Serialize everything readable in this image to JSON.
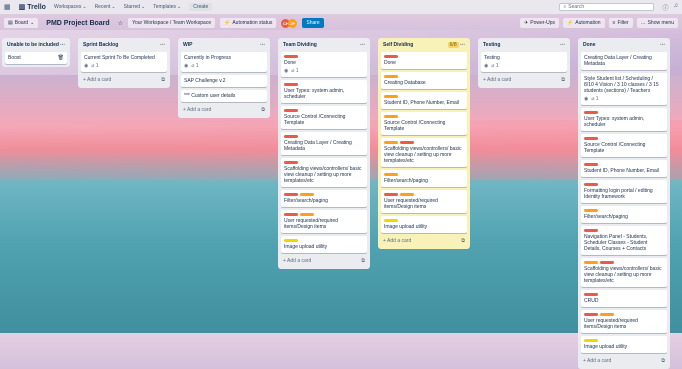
{
  "topbar": {
    "app": "Trello",
    "nav": [
      "Workspaces",
      "Recent",
      "Starred",
      "Templates"
    ],
    "create": "Create",
    "search_placeholder": "Search"
  },
  "boardbar": {
    "view": "Board",
    "title": "PMD Project Board",
    "visibility": "Your Workspace / Team Workspace",
    "workspace": "Automation status",
    "avatars": [
      "CH",
      "JP"
    ],
    "share": "Share",
    "powerups": "Power-Ups",
    "automation": "Automation",
    "filter": "Filter",
    "menu": "Show menu"
  },
  "colors": {
    "accent": "#0079bf",
    "topbar": "#ebecf0"
  },
  "lists": [
    {
      "title": "Unable to be included",
      "narrow": true,
      "cards": [
        {
          "text": "Boost",
          "labels": [],
          "icon": "trash-icon"
        }
      ],
      "add": ""
    },
    {
      "title": "Sprint Backlog",
      "cards": [
        {
          "text": "Current Sprint To Be Completed",
          "labels": [],
          "badge": "1"
        }
      ],
      "add": "Add a card"
    },
    {
      "title": "WIP",
      "cards": [
        {
          "text": "Currently in Progress",
          "labels": [],
          "badge": "1"
        },
        {
          "text": "SAP Challenge v.2",
          "labels": []
        },
        {
          "text": "*** Custom user details",
          "labels": []
        }
      ],
      "add": "Add a card"
    },
    {
      "title": "Team Dividing",
      "cards": [
        {
          "text": "Done",
          "labels": [
            "red"
          ],
          "badge": "1"
        },
        {
          "text": "User Types: system admin, scheduler",
          "labels": [
            "red"
          ]
        },
        {
          "text": "Source Control /Connecting Template",
          "labels": [
            "red"
          ]
        },
        {
          "text": "Creating Data Layer / Creating Metadata",
          "labels": [
            "red"
          ]
        },
        {
          "text": "Scaffolding views/controllers/ basic view cleanup / setting up more templates/etc",
          "labels": [
            "red"
          ]
        },
        {
          "text": "Filter/search/paging",
          "labels": [
            "red",
            "orange"
          ]
        },
        {
          "text": "User requested/required items/Design items",
          "labels": [
            "red",
            "orange"
          ]
        },
        {
          "text": "Image upload utility",
          "labels": [
            "yellow"
          ]
        }
      ],
      "add": "Add a card"
    },
    {
      "title": "Self Dividing",
      "yellow": true,
      "count": "6/8",
      "cards": [
        {
          "text": "Done",
          "labels": [
            "red"
          ]
        },
        {
          "text": "Creating Database",
          "labels": [
            "orange"
          ]
        },
        {
          "text": "Student ID, Phone Number, Email",
          "labels": [
            "orange"
          ]
        },
        {
          "text": "Source Control /Connecting Template",
          "labels": [
            "orange"
          ]
        },
        {
          "text": "Scaffolding views/controllers/ basic view cleanup / setting up more templates/etc",
          "labels": [
            "orange",
            "red"
          ]
        },
        {
          "text": "Filter/search/paging",
          "labels": [
            "orange"
          ]
        },
        {
          "text": "User requested/required items/Design items",
          "labels": [
            "red",
            "orange"
          ]
        },
        {
          "text": "Image upload utility",
          "labels": [
            "yellow"
          ]
        }
      ],
      "add": "Add a card"
    },
    {
      "title": "Testing",
      "cards": [
        {
          "text": "Testing",
          "labels": [],
          "badge": "1"
        }
      ],
      "add": "Add a card"
    },
    {
      "title": "Done",
      "cards": [
        {
          "text": "Creating Data Layer / Creating Metadata",
          "labels": []
        },
        {
          "text": "Style Student list / Scheduling / 8/10 4 Vision / 3 10 classes / 3 15 students (sections) / Teachers",
          "labels": [],
          "badge": "1"
        },
        {
          "text": "User Types: system admin, scheduler",
          "labels": [
            "red"
          ]
        },
        {
          "text": "Source Control /Connecting Template",
          "labels": [
            "red"
          ]
        },
        {
          "text": "Student ID, Phone Number, Email",
          "labels": [
            "red"
          ]
        },
        {
          "text": "Formatting login portal / editing Identity framework",
          "labels": [
            "red"
          ]
        },
        {
          "text": "Filter/search/paging",
          "labels": [
            "orange"
          ]
        },
        {
          "text": "Navigation Panel - Students, Scheduler Classes - Student Details, Courses + Contacts",
          "labels": [
            "red"
          ]
        },
        {
          "text": "Scaffolding views/controllers/ basic view cleanup / setting up more templates/etc",
          "labels": [
            "orange",
            "red"
          ]
        },
        {
          "text": "CRUD",
          "labels": [
            "red"
          ]
        },
        {
          "text": "User requested/required items/Design items",
          "labels": [
            "red",
            "orange"
          ]
        },
        {
          "text": "Image upload utility",
          "labels": [
            "yellow"
          ]
        }
      ],
      "add": "Add a card"
    }
  ]
}
